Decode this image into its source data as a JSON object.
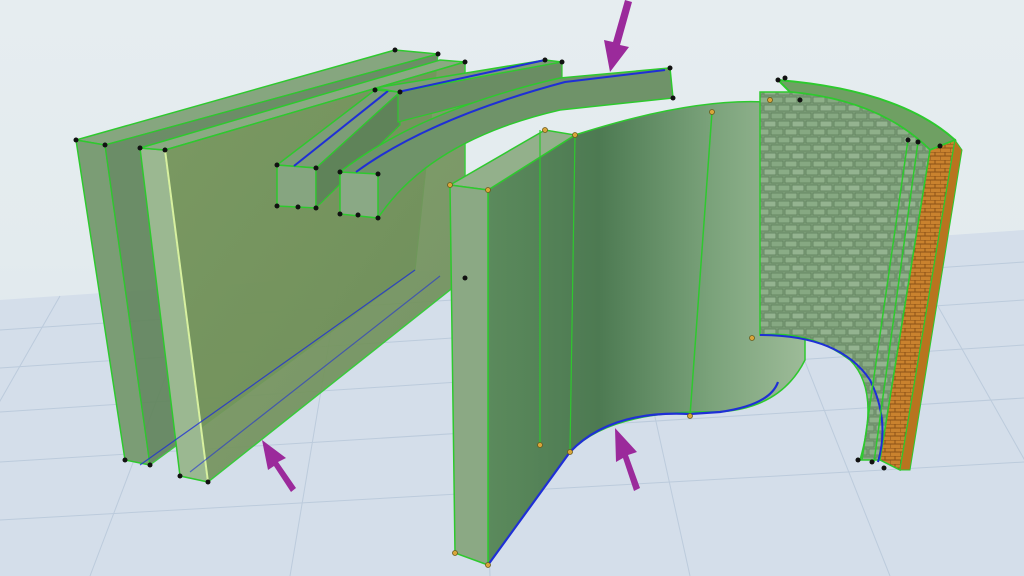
{
  "scene": {
    "ground_color": "#d4deea",
    "grid_color": "#b9c9da",
    "element_fill": "#6f9a6a",
    "edge_color": "#2ec92e",
    "reference_line_color": "#1f2fd6",
    "arrow_color": "#9b2a9b",
    "brick_color": "#c9822e",
    "stone_color": "#7ea07a",
    "node_color": "#111111"
  },
  "elements": [
    {
      "icon": "straight-wall-3d"
    },
    {
      "icon": "straight-wall-3d"
    },
    {
      "icon": "straight-beam-3d"
    },
    {
      "icon": "curved-beam-3d"
    },
    {
      "icon": "curved-wall-3d"
    },
    {
      "icon": "composite-curved-wall-3d"
    }
  ],
  "annotations": [
    {
      "icon": "arrow-pointer-icon"
    },
    {
      "icon": "arrow-pointer-icon"
    },
    {
      "icon": "arrow-pointer-icon"
    }
  ]
}
